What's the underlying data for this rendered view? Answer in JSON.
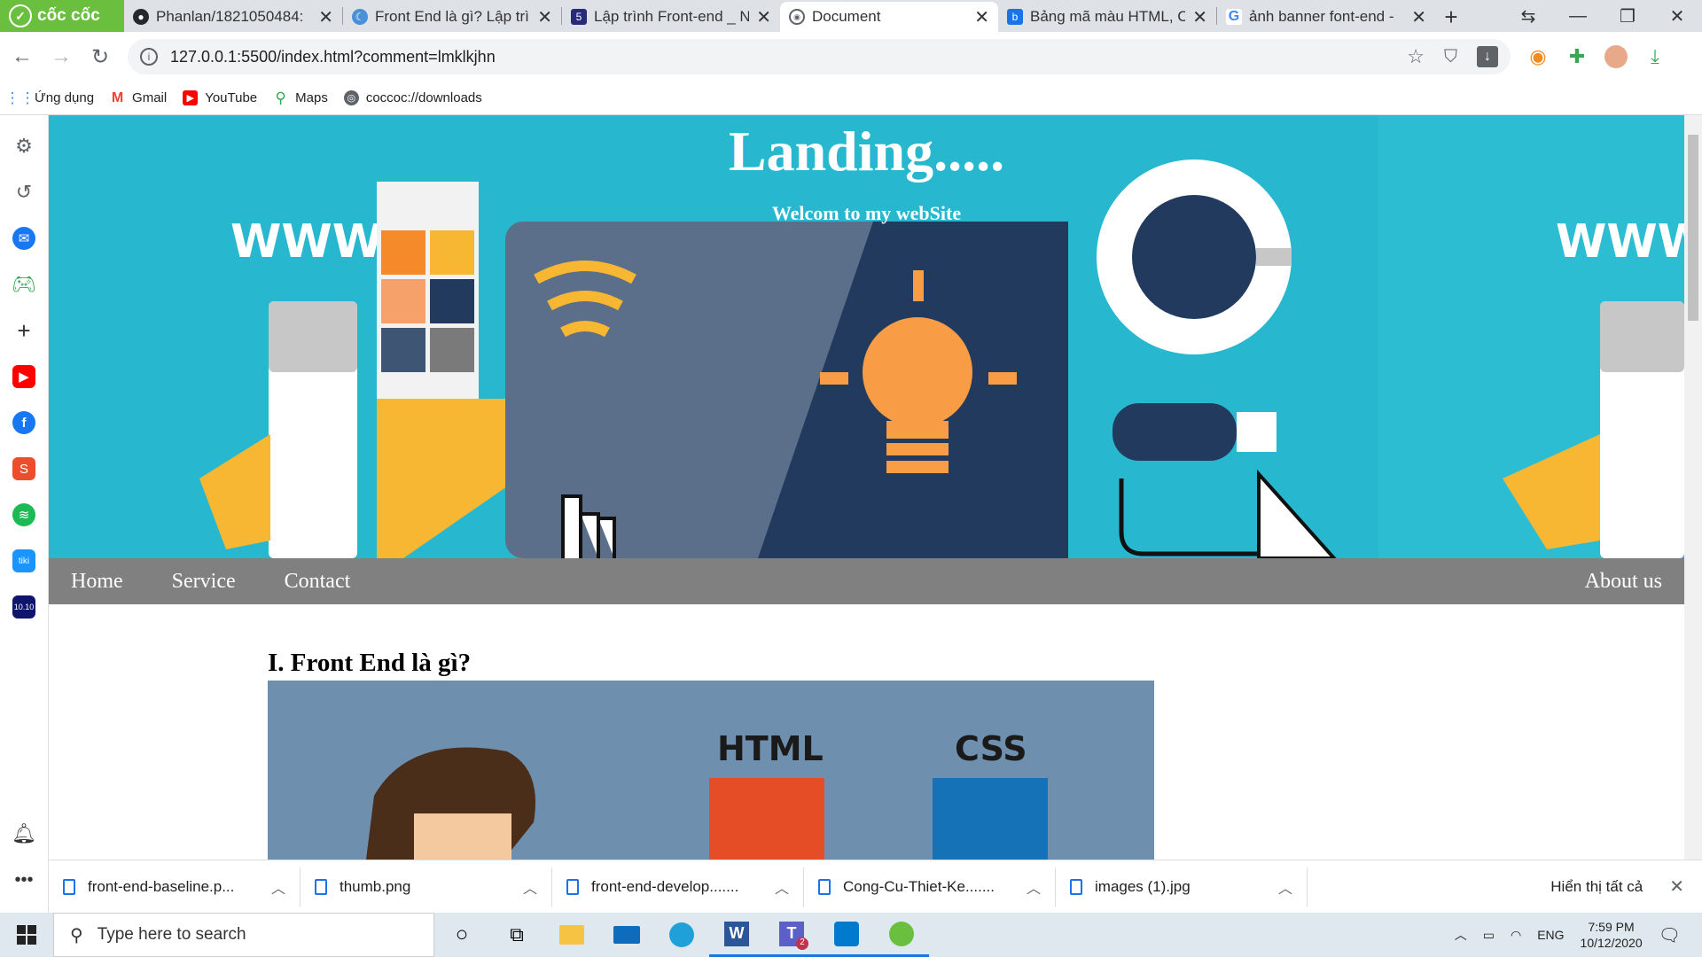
{
  "browser": {
    "brand": "cốc cốc",
    "tabs": [
      {
        "title": "Phanlan/1821050484:",
        "icon": "github-icon"
      },
      {
        "title": "Front End là gì? Lập trì",
        "icon": "coccoc-icon"
      },
      {
        "title": "Lập trình Front-end _ N",
        "icon": "site-icon"
      },
      {
        "title": "Document",
        "icon": "globe-icon",
        "active": true
      },
      {
        "title": "Bảng mã màu HTML, C",
        "icon": "b-icon"
      },
      {
        "title": "ảnh banner font-end -",
        "icon": "google-icon"
      }
    ],
    "url": "127.0.0.1:5500/index.html?comment=lmklkjhn",
    "bookmarks": [
      "Ứng dụng",
      "Gmail",
      "YouTube",
      "Maps",
      "coccoc://downloads"
    ]
  },
  "page": {
    "banner_title": "Landing.....",
    "banner_subtitle": "Welcom to my webSite",
    "nav": {
      "home": "Home",
      "service": "Service",
      "contact": "Contact",
      "about": "About us"
    },
    "section_heading": "I. Front End là gì?",
    "image_labels": {
      "html": "HTML",
      "css": "CSS"
    }
  },
  "downloads": {
    "items": [
      "front-end-baseline.p...",
      "thumb.png",
      "front-end-develop.......",
      "Cong-Cu-Thiet-Ke.......",
      "images (1).jpg"
    ],
    "show_all": "Hiển thị tất cả"
  },
  "taskbar": {
    "search_placeholder": "Type here to search",
    "lang": "ENG",
    "time": "7:59 PM",
    "date": "10/12/2020",
    "teams_badge": "2"
  },
  "colors": {
    "banner": "#27b8d0",
    "nav": "#808080",
    "brand": "#6bbf3f"
  }
}
